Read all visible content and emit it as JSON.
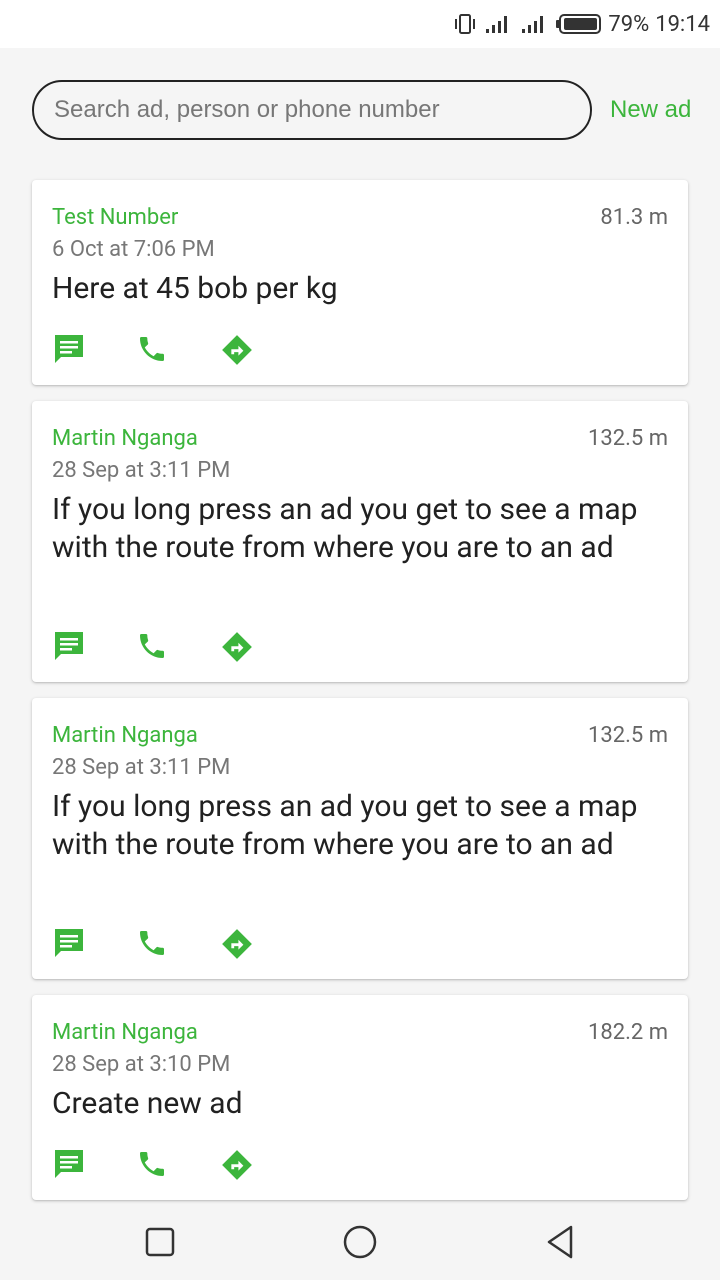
{
  "status_bar": {
    "battery": "79%",
    "time": "19:14"
  },
  "search": {
    "placeholder": "Search ad, person or phone number",
    "value": "",
    "new_ad_label": "New ad"
  },
  "colors": {
    "accent": "#3cb53c"
  },
  "ads": [
    {
      "name": "Test Number",
      "distance": "81.3 m",
      "date": "6 Oct at 7:06 PM",
      "text": "Here at 45 bob per kg",
      "actions": [
        "message-icon",
        "phone-icon",
        "directions-icon"
      ]
    },
    {
      "name": "Martin Nganga",
      "distance": "132.5 m",
      "date": "28 Sep at 3:11 PM",
      "text": "If you long press an ad you get to see a map with the route from where you are to an ad",
      "actions": [
        "message-icon",
        "phone-icon",
        "directions-icon"
      ]
    },
    {
      "name": "Martin Nganga",
      "distance": "132.5 m",
      "date": "28 Sep at 3:11 PM",
      "text": "If you long press an ad you get to see a map with the route from where you are to an ad",
      "actions": [
        "message-icon",
        "phone-icon",
        "directions-icon"
      ]
    },
    {
      "name": "Martin Nganga",
      "distance": "182.2 m",
      "date": "28 Sep at 3:10 PM",
      "text": "Create new ad",
      "actions": [
        "message-icon",
        "phone-icon",
        "directions-icon"
      ]
    }
  ],
  "nav_bar": {
    "buttons": [
      "recents-square-icon",
      "home-circle-icon",
      "back-triangle-icon"
    ]
  }
}
